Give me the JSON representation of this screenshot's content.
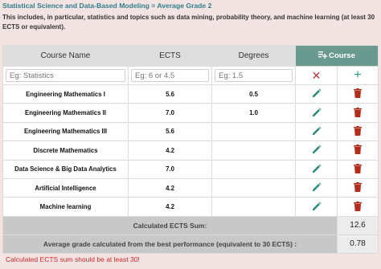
{
  "header": {
    "title": "Statistical Science and Data-Based Modeling = Average Grade 2",
    "description": "This includes, in particular, statistics and topics such as data mining, probability theory, and machine learning (at least 30 ECTS or equivalent)."
  },
  "table": {
    "columns": {
      "course_name": "Course Name",
      "ects": "ECTS",
      "degrees": "Degrees",
      "add_course": "Course"
    },
    "inputs": {
      "course_placeholder": "Eg: Statistics",
      "ects_placeholder": "Eg: 6 or 4.5",
      "degree_placeholder": "Eg: 1.5"
    },
    "rows": [
      {
        "name": "Engineering Mathematics I",
        "ects": "5.6",
        "degree": "0.5"
      },
      {
        "name": "Engineering Mathematics II",
        "ects": "7.0",
        "degree": "1.0"
      },
      {
        "name": "Engineering Mathematics III",
        "ects": "5.6",
        "degree": ""
      },
      {
        "name": "Discrete Mathematics",
        "ects": "4.2",
        "degree": ""
      },
      {
        "name": "Data Science & Big Data Analytics",
        "ects": "7.0",
        "degree": ""
      },
      {
        "name": "Artificial Intelligence",
        "ects": "4.2",
        "degree": ""
      },
      {
        "name": "Machine learning",
        "ects": "4.2",
        "degree": ""
      }
    ],
    "summary": {
      "ects_sum_label": "Calculated ECTS Sum:",
      "ects_sum_value": "12.6",
      "avg_label": "Average grade calculated from the best performance (equivalent to 30 ECTS) :",
      "avg_value": "0.78"
    }
  },
  "warning": "Calculated ECTS sum should be at least 30!",
  "colors": {
    "page_bg": "#f3e3e3",
    "title": "#2f7f8a",
    "course_header": "#6a9a8f",
    "edit_icon": "#2a8a7a",
    "delete_icon": "#b52b1c",
    "warning": "#d12a2a"
  }
}
